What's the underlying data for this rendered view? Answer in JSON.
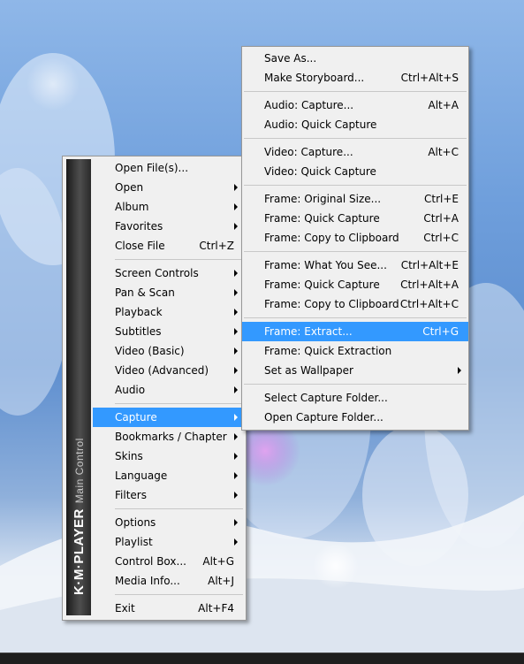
{
  "colors": {
    "highlight": "#3399ff",
    "menu_bg": "#f0f0f0",
    "brand_bar": "#2e2e2e"
  },
  "brand": {
    "name": "K·M·PLAYER",
    "subtitle": "Main Control"
  },
  "main_menu": {
    "items": [
      {
        "label": "Open File(s)...",
        "shortcut": "",
        "submenu": false
      },
      {
        "label": "Open",
        "shortcut": "",
        "submenu": true
      },
      {
        "label": "Album",
        "shortcut": "",
        "submenu": true
      },
      {
        "label": "Favorites",
        "shortcut": "",
        "submenu": true
      },
      {
        "label": "Close File",
        "shortcut": "Ctrl+Z",
        "submenu": false
      },
      {
        "label": "Screen Controls",
        "shortcut": "",
        "submenu": true
      },
      {
        "label": "Pan & Scan",
        "shortcut": "",
        "submenu": true
      },
      {
        "label": "Playback",
        "shortcut": "",
        "submenu": true
      },
      {
        "label": "Subtitles",
        "shortcut": "",
        "submenu": true
      },
      {
        "label": "Video (Basic)",
        "shortcut": "",
        "submenu": true
      },
      {
        "label": "Video (Advanced)",
        "shortcut": "",
        "submenu": true
      },
      {
        "label": "Audio",
        "shortcut": "",
        "submenu": true
      },
      {
        "label": "Capture",
        "shortcut": "",
        "submenu": true,
        "highlighted": true
      },
      {
        "label": "Bookmarks / Chapter",
        "shortcut": "",
        "submenu": true
      },
      {
        "label": "Skins",
        "shortcut": "",
        "submenu": true
      },
      {
        "label": "Language",
        "shortcut": "",
        "submenu": true
      },
      {
        "label": "Filters",
        "shortcut": "",
        "submenu": true
      },
      {
        "label": "Options",
        "shortcut": "",
        "submenu": true
      },
      {
        "label": "Playlist",
        "shortcut": "",
        "submenu": true
      },
      {
        "label": "Control Box...",
        "shortcut": "Alt+G",
        "submenu": false
      },
      {
        "label": "Media Info...",
        "shortcut": "Alt+J",
        "submenu": false
      },
      {
        "label": "Exit",
        "shortcut": "Alt+F4",
        "submenu": false
      }
    ]
  },
  "capture_menu": {
    "items": [
      {
        "label": "Save As...",
        "shortcut": "",
        "submenu": false
      },
      {
        "label": "Make Storyboard...",
        "shortcut": "Ctrl+Alt+S",
        "submenu": false
      },
      {
        "label": "Audio: Capture...",
        "shortcut": "Alt+A",
        "submenu": false
      },
      {
        "label": "Audio: Quick Capture",
        "shortcut": "",
        "submenu": false
      },
      {
        "label": "Video: Capture...",
        "shortcut": "Alt+C",
        "submenu": false
      },
      {
        "label": "Video: Quick Capture",
        "shortcut": "",
        "submenu": false
      },
      {
        "label": "Frame: Original Size...",
        "shortcut": "Ctrl+E",
        "submenu": false
      },
      {
        "label": "Frame: Quick Capture",
        "shortcut": "Ctrl+A",
        "submenu": false
      },
      {
        "label": "Frame: Copy to Clipboard",
        "shortcut": "Ctrl+C",
        "submenu": false
      },
      {
        "label": "Frame: What You See...",
        "shortcut": "Ctrl+Alt+E",
        "submenu": false
      },
      {
        "label": "Frame: Quick Capture",
        "shortcut": "Ctrl+Alt+A",
        "submenu": false
      },
      {
        "label": "Frame: Copy to Clipboard",
        "shortcut": "Ctrl+Alt+C",
        "submenu": false
      },
      {
        "label": "Frame: Extract...",
        "shortcut": "Ctrl+G",
        "submenu": false,
        "highlighted": true
      },
      {
        "label": "Frame: Quick Extraction",
        "shortcut": "",
        "submenu": false
      },
      {
        "label": "Set as Wallpaper",
        "shortcut": "",
        "submenu": true
      },
      {
        "label": "Select Capture Folder...",
        "shortcut": "",
        "submenu": false
      },
      {
        "label": "Open Capture Folder...",
        "shortcut": "",
        "submenu": false
      }
    ]
  }
}
